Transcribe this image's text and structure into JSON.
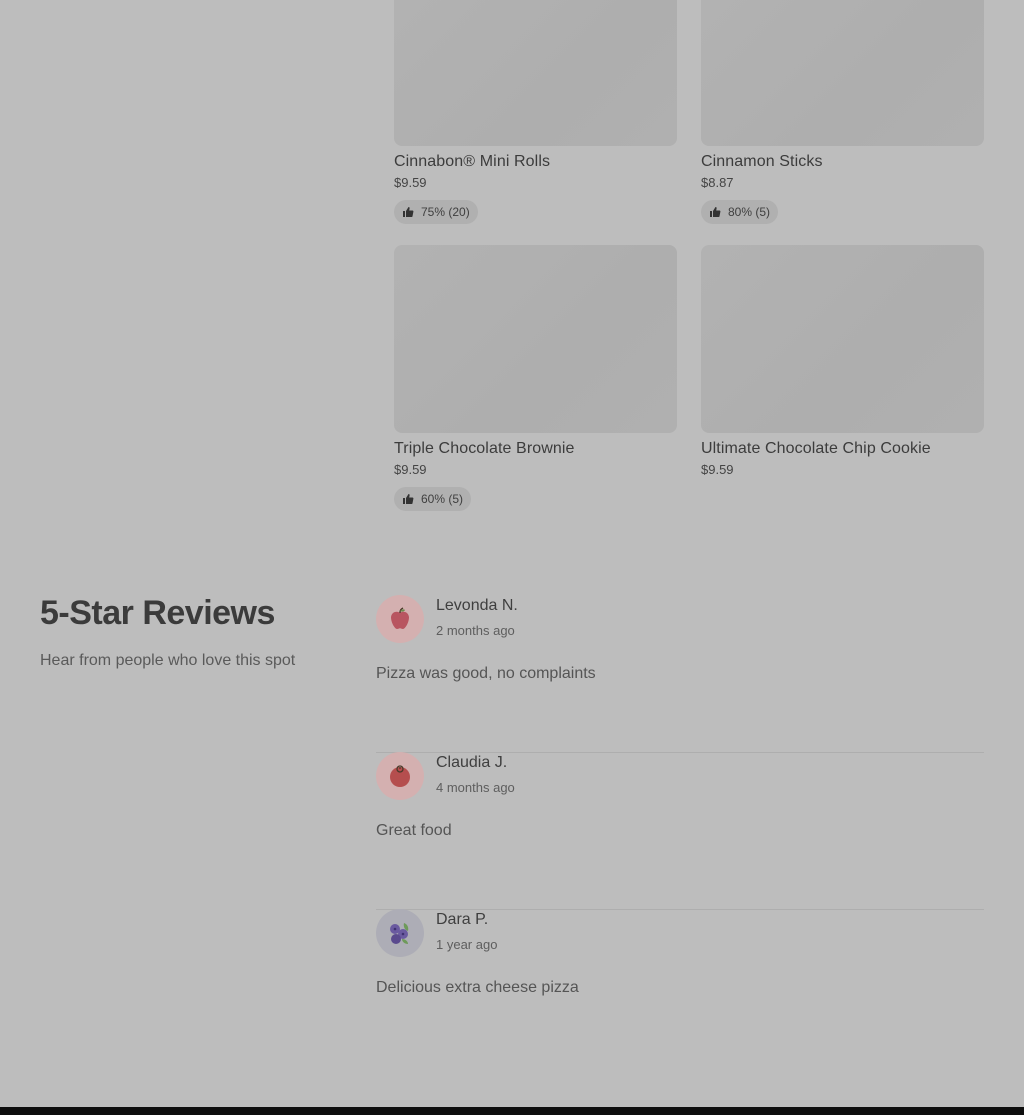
{
  "products": [
    {
      "name": "Cinnabon® Mini Rolls",
      "price": "$9.59",
      "rating": "75% (20)"
    },
    {
      "name": "Cinnamon Sticks",
      "price": "$8.87",
      "rating": "80% (5)"
    },
    {
      "name": "Triple Chocolate Brownie",
      "price": "$9.59",
      "rating": "60% (5)"
    },
    {
      "name": "Ultimate Chocolate Chip Cookie",
      "price": "$9.59",
      "rating": null
    }
  ],
  "reviews_section": {
    "title": "5-Star Reviews",
    "subtitle": "Hear from people who love this spot",
    "reviews": [
      {
        "name": "Levonda N.",
        "date": "2 months ago",
        "text": "Pizza was good, no complaints",
        "avatar_icon": "apple-icon"
      },
      {
        "name": "Claudia J.",
        "date": "4 months ago",
        "text": "Great food",
        "avatar_icon": "tomato-icon"
      },
      {
        "name": "Dara P.",
        "date": "1 year ago",
        "text": "Delicious extra cheese pizza",
        "avatar_icon": "blueberries-icon"
      }
    ]
  },
  "colors": {
    "overlay_background": "#bdbdbd",
    "footer": "#0e0e0e"
  },
  "icons": {
    "rating": "thumbs-up-icon"
  }
}
